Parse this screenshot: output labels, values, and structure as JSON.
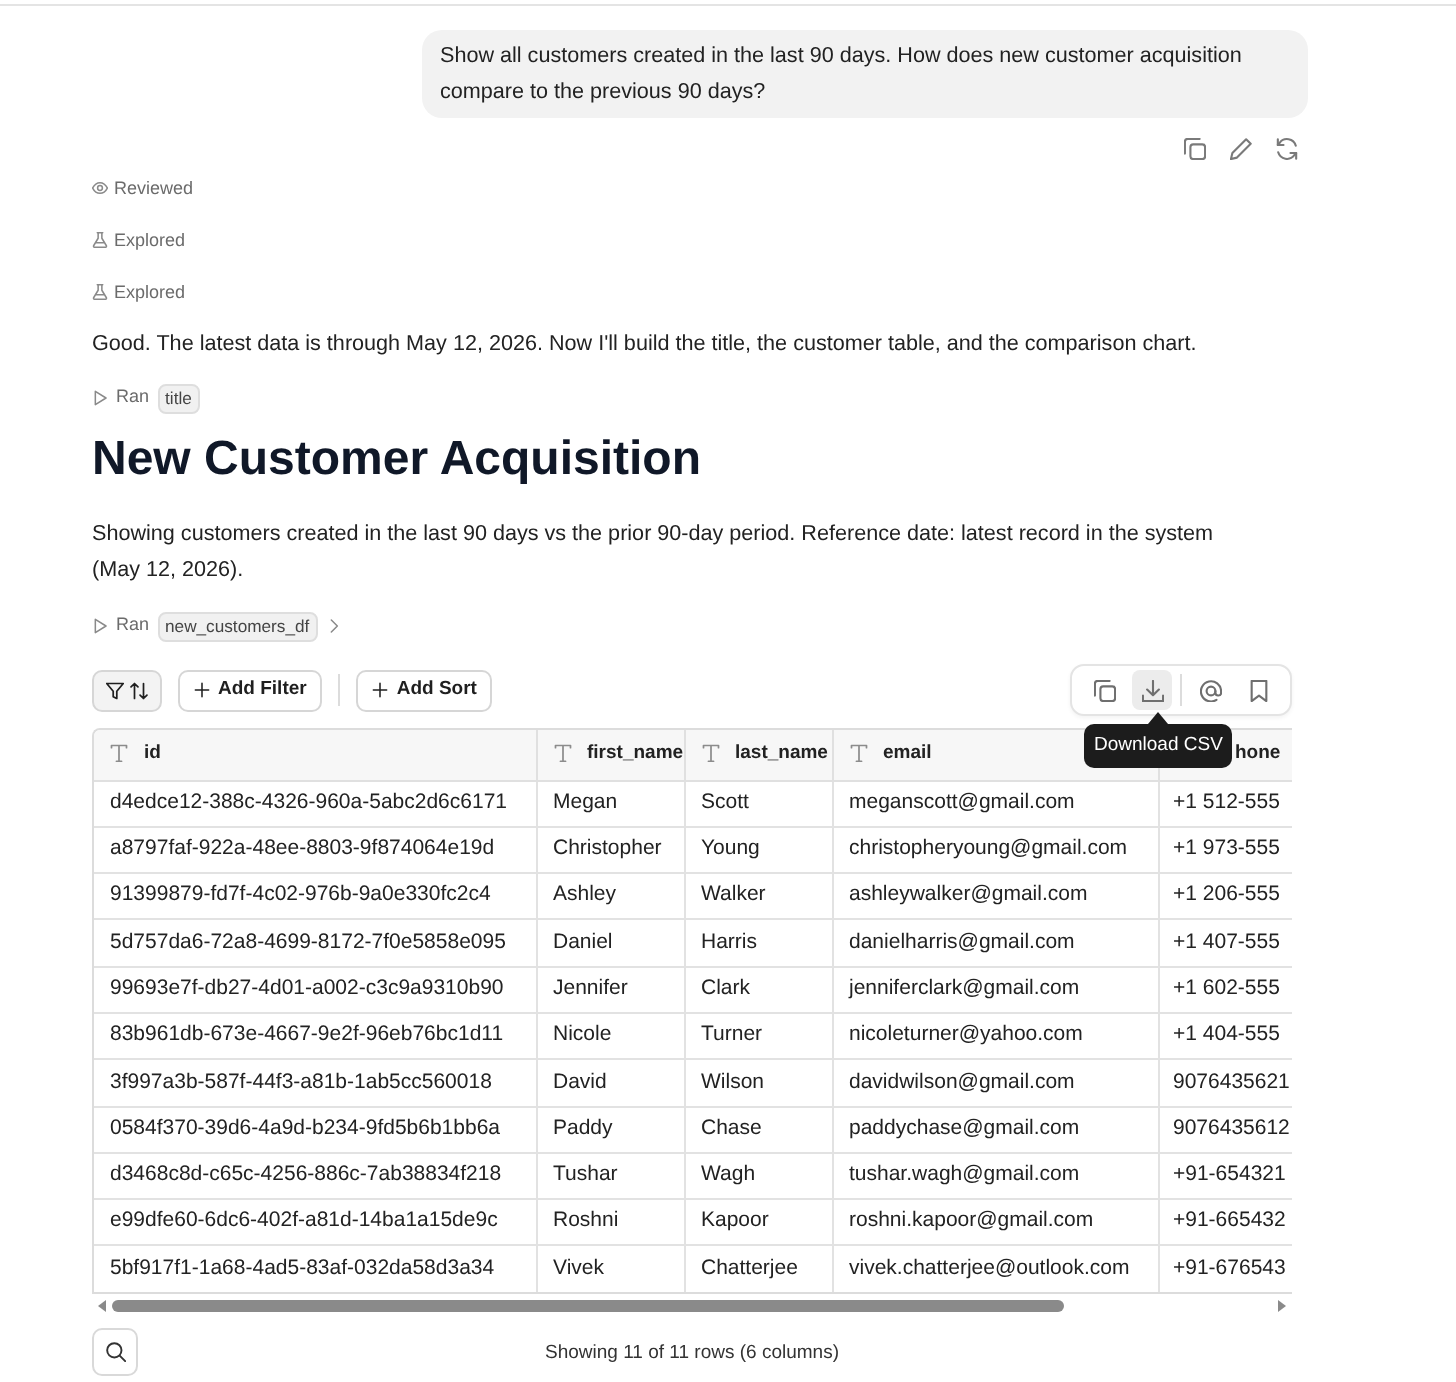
{
  "user_message": {
    "text": "Show all customers created in the last 90 days. How does new customer acquisition compare to the previous 90 days?"
  },
  "steps": [
    {
      "kind": "review",
      "label": "Reviewed"
    },
    {
      "kind": "explore",
      "label": "Explored"
    },
    {
      "kind": "explore",
      "label": "Explored"
    }
  ],
  "reply": {
    "text": "Good. The latest data is through May 12, 2026. Now I'll build the title, the customer table, and the comparison chart."
  },
  "run_title": {
    "label": "Ran",
    "tag": "title"
  },
  "title": "New Customer Acquisition",
  "description": "Showing customers created in the last 90 days vs the prior 90-day period. Reference date: latest record in the system (May 12, 2026).",
  "run_table": {
    "label": "Ran",
    "tag": "new_customers_df",
    "expanded": false
  },
  "toolbar_groups": [
    [
      {
        "kind": "filter_sort"
      },
      {
        "kind": "add",
        "label": "Add Filter"
      }
    ],
    [
      {
        "kind": "add",
        "label": "Add Sort"
      }
    ]
  ],
  "table_action_groups": [
    [
      {
        "kind": "copy",
        "highlighted": false
      },
      {
        "kind": "download",
        "highlighted": true
      }
    ],
    [
      {
        "kind": "mention",
        "highlighted": false
      },
      {
        "kind": "bookmark",
        "highlighted": false
      }
    ]
  ],
  "tooltip": {
    "text": "Download CSV"
  },
  "table": {
    "columns": [
      {
        "label": "id",
        "kind": "text"
      },
      {
        "label": "first_name",
        "kind": "text"
      },
      {
        "label": "last_name",
        "kind": "text"
      },
      {
        "label": "email",
        "kind": "text"
      },
      {
        "label": "hone"
      }
    ],
    "rows": [
      [
        "d4edce12-388c-4326-960a-5abc2d6c6171",
        "Megan",
        "Scott",
        "meganscott@gmail.com",
        "+1 512-555"
      ],
      [
        "a8797faf-922a-48ee-8803-9f874064e19d",
        "Christopher",
        "Young",
        "christopheryoung@gmail.com",
        "+1 973-555"
      ],
      [
        "91399879-fd7f-4c02-976b-9a0e330fc2c4",
        "Ashley",
        "Walker",
        "ashleywalker@gmail.com",
        "+1 206-555"
      ],
      [
        "5d757da6-72a8-4699-8172-7f0e5858e095",
        "Daniel",
        "Harris",
        "danielharris@gmail.com",
        "+1 407-555"
      ],
      [
        "99693e7f-db27-4d01-a002-c3c9a9310b90",
        "Jennifer",
        "Clark",
        "jenniferclark@gmail.com",
        "+1 602-555"
      ],
      [
        "83b961db-673e-4667-9e2f-96eb76bc1d11",
        "Nicole",
        "Turner",
        "nicoleturner@yahoo.com",
        "+1 404-555"
      ],
      [
        "3f997a3b-587f-44f3-a81b-1ab5cc560018",
        "David",
        "Wilson",
        "davidwilson@gmail.com",
        "9076435621"
      ],
      [
        "0584f370-39d6-4a9d-b234-9fd5b6b1bb6a",
        "Paddy",
        "Chase",
        "paddychase@gmail.com",
        "9076435612"
      ],
      [
        "d3468c8d-c65c-4256-886c-7ab38834f218",
        "Tushar",
        "Wagh",
        "tushar.wagh@gmail.com",
        "+91-654321"
      ],
      [
        "e99dfe60-6dc6-402f-a81d-14ba1a15de9c",
        "Roshni",
        "Kapoor",
        "roshni.kapoor@gmail.com",
        "+91-665432"
      ],
      [
        "5bf917f1-1a68-4ad5-83af-032da58d3a34",
        "Vivek",
        "Chatterjee",
        "vivek.chatterjee@outlook.com",
        "+91-676543"
      ]
    ]
  },
  "footer": {
    "summary": "Showing 11 of 11 rows (6 columns)"
  }
}
